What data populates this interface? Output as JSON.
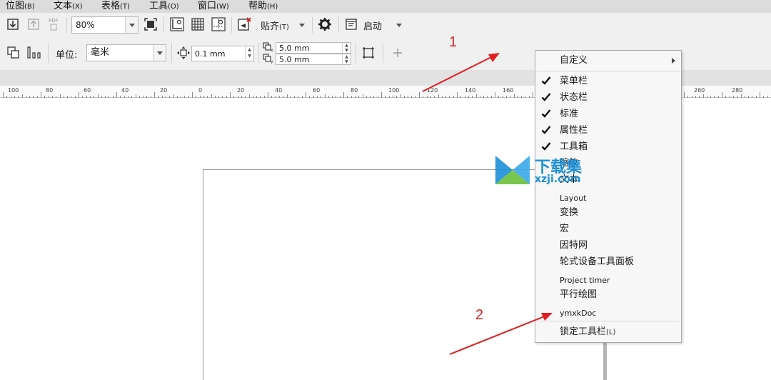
{
  "menubar": {
    "items": [
      {
        "label": "位图",
        "accel": "(B)"
      },
      {
        "label": "文本",
        "accel": "(X)"
      },
      {
        "label": "表格",
        "accel": "(T)"
      },
      {
        "label": "工具",
        "accel": "(O)"
      },
      {
        "label": "窗口",
        "accel": "(W)"
      },
      {
        "label": "帮助",
        "accel": "(H)"
      }
    ]
  },
  "toolbar": {
    "pdf_label": "PDF",
    "zoom_value": "80%",
    "snap_label": "贴齐",
    "snap_accel": "(T)",
    "launch_label": "启动"
  },
  "property_bar": {
    "unit_label": "单位:",
    "unit_value": "毫米",
    "nudge_value": "0.1 mm",
    "dup_x_value": "5.0 mm",
    "dup_y_value": "5.0 mm"
  },
  "ruler": {
    "labels": [
      "100",
      "80",
      "60",
      "40",
      "20",
      "0",
      "20",
      "40",
      "60",
      "80",
      "100",
      "120",
      "140",
      "160",
      "260",
      "280"
    ]
  },
  "context_menu": {
    "customize": "自定义",
    "items": [
      {
        "label": "菜单栏",
        "checked": true
      },
      {
        "label": "状态栏",
        "checked": true
      },
      {
        "label": "标准",
        "checked": true
      },
      {
        "label": "属性栏",
        "checked": true
      },
      {
        "label": "工具箱",
        "checked": true
      },
      {
        "label": "缩放",
        "checked": false
      },
      {
        "label": "文本",
        "checked": false
      },
      {
        "label": "Layout",
        "checked": false
      },
      {
        "label": "变换",
        "checked": false
      },
      {
        "label": "宏",
        "checked": false
      },
      {
        "label": "因特网",
        "checked": false
      },
      {
        "label": "轮式设备工具面板",
        "checked": false
      },
      {
        "label": "Project timer",
        "checked": false
      },
      {
        "label": "平行绘图",
        "checked": false
      },
      {
        "label": "ymxkDoc",
        "checked": false
      }
    ],
    "lock_label": "锁定工具栏",
    "lock_accel": "(L)"
  },
  "watermark": {
    "text": "下载集",
    "sub": "xzji.com"
  },
  "annotations": {
    "first": "1",
    "second": "2"
  },
  "colors": {
    "accent": "#e02020",
    "watermark": "#1b8fd6"
  }
}
